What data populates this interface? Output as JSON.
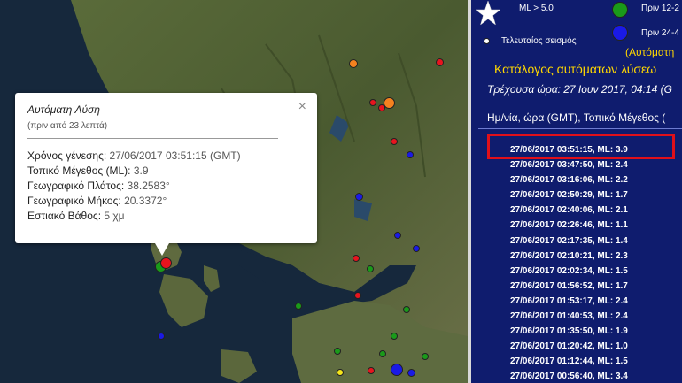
{
  "popup": {
    "title": "Αυτόματη Λύση",
    "ago": "(πριν από 23 λεπτά)",
    "close_symbol": "×",
    "rows": [
      {
        "label": "Χρόνος γένεσης:",
        "value": "27/06/2017  03:51:15 (GMT)"
      },
      {
        "label": "Τοπικό Μέγεθος (ML):",
        "value": "3.9"
      },
      {
        "label": "Γεωγραφικό Πλάτος:",
        "value": "38.2583°"
      },
      {
        "label": "Γεωγραφικό Μήκος:",
        "value": "20.3372°"
      },
      {
        "label": "Εστιακό Βάθος:",
        "value": "5 χμ"
      }
    ]
  },
  "legend": {
    "ml5": "ML > 5.0",
    "last_quake": "Τελευταίος σεισμός",
    "prev12": "Πριν 12-2",
    "prev24": "Πριν 24-4",
    "auto": "(Αυτόματη"
  },
  "catalog": {
    "title": "Κατάλογος αυτόματων λύσεω",
    "current_time": "Τρέχουσα ώρα: 27 Ιουν 2017, 04:14 (G",
    "column_header": "Ημ/νία, ώρα (GMT), Τοπικό Μέγεθος (",
    "entries": [
      "27/06/2017  03:51:15,   ML: 3.9",
      "27/06/2017  03:47:50,   ML: 2.4",
      "27/06/2017  03:16:06,   ML: 2.2",
      "27/06/2017  02:50:29,   ML: 1.7",
      "27/06/2017  02:40:06,   ML: 2.1",
      "27/06/2017  02:26:46,   ML: 1.1",
      "27/06/2017  02:17:35,   ML: 1.4",
      "27/06/2017  02:10:21,   ML: 2.3",
      "27/06/2017  02:02:34,   ML: 1.5",
      "27/06/2017  01:56:52,   ML: 1.7",
      "27/06/2017  01:53:17,   ML: 2.4",
      "27/06/2017  01:40:53,   ML: 2.4",
      "27/06/2017  01:35:50,   ML: 1.9",
      "27/06/2017  01:20:42,   ML: 1.0",
      "27/06/2017  01:12:44,   ML: 1.5",
      "27/06/2017  00:56:40,   ML: 3.4"
    ]
  },
  "colors": {
    "red": "#e8141e",
    "orange": "#f5821f",
    "green": "#1a9a1a",
    "blue": "#1a1ae6",
    "yellow": "#f5e61a",
    "panel_bg": "#0f1c6e",
    "highlight": "#e0101a"
  }
}
